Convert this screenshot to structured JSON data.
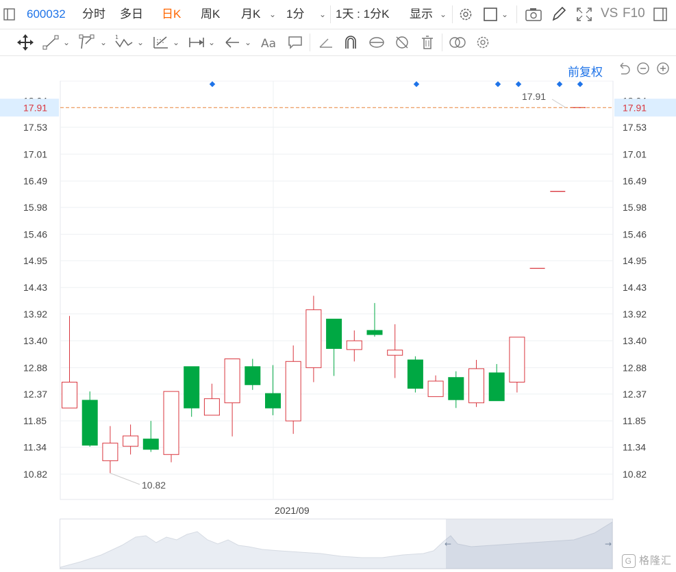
{
  "toolbar": {
    "symbol": "600032",
    "tabs": [
      "分时",
      "多日",
      "日K",
      "周K",
      "月K",
      "1分"
    ],
    "active_tab": "日K",
    "interval_label": "1天 : 1分K",
    "display_label": "显示",
    "vs_label": "VS",
    "f10_label": "F10"
  },
  "adjust_label": "前复权",
  "chart": {
    "current_price": "17.91",
    "high_label": "17.91",
    "low_label": "10.82",
    "top_axis_partial": "18.04",
    "x_label": "2021/09",
    "y_ticks": [
      "17.53",
      "17.01",
      "16.49",
      "15.98",
      "15.46",
      "14.95",
      "14.43",
      "13.92",
      "13.40",
      "12.88",
      "12.37",
      "11.85",
      "11.34",
      "10.82"
    ]
  },
  "colors": {
    "up": "#d9363e",
    "down": "#00a843",
    "accent": "#1e73e8",
    "active": "#ff6600"
  },
  "watermark": "格隆汇",
  "chart_data": {
    "type": "candlestick",
    "x_label": "2021/09",
    "ylim": [
      10.82,
      18.04
    ],
    "candles": [
      {
        "o": 12.1,
        "h": 13.88,
        "l": 12.1,
        "c": 12.6
      },
      {
        "o": 12.25,
        "h": 12.42,
        "l": 11.35,
        "c": 11.38
      },
      {
        "o": 11.08,
        "h": 11.75,
        "l": 10.84,
        "c": 11.42
      },
      {
        "o": 11.36,
        "h": 11.78,
        "l": 11.2,
        "c": 11.56
      },
      {
        "o": 11.5,
        "h": 11.85,
        "l": 11.25,
        "c": 11.3
      },
      {
        "o": 11.2,
        "h": 12.4,
        "l": 11.05,
        "c": 12.42
      },
      {
        "o": 12.9,
        "h": 12.9,
        "l": 11.93,
        "c": 12.1
      },
      {
        "o": 11.96,
        "h": 12.57,
        "l": 11.96,
        "c": 12.28
      },
      {
        "o": 12.2,
        "h": 13.05,
        "l": 11.55,
        "c": 13.05
      },
      {
        "o": 12.9,
        "h": 13.05,
        "l": 12.45,
        "c": 12.55
      },
      {
        "o": 12.38,
        "h": 12.93,
        "l": 11.96,
        "c": 12.1
      },
      {
        "o": 11.85,
        "h": 13.31,
        "l": 11.6,
        "c": 13.0
      },
      {
        "o": 12.88,
        "h": 14.27,
        "l": 12.6,
        "c": 14.0
      },
      {
        "o": 13.82,
        "h": 13.82,
        "l": 12.72,
        "c": 13.25
      },
      {
        "o": 13.23,
        "h": 13.6,
        "l": 13.0,
        "c": 13.4
      },
      {
        "o": 13.6,
        "h": 14.13,
        "l": 13.48,
        "c": 13.52
      },
      {
        "o": 13.12,
        "h": 13.72,
        "l": 12.68,
        "c": 13.22
      },
      {
        "o": 13.03,
        "h": 13.1,
        "l": 12.4,
        "c": 12.48
      },
      {
        "o": 12.32,
        "h": 12.73,
        "l": 12.32,
        "c": 12.62
      },
      {
        "o": 12.69,
        "h": 12.81,
        "l": 12.1,
        "c": 12.26
      },
      {
        "o": 12.2,
        "h": 13.03,
        "l": 12.12,
        "c": 12.86
      },
      {
        "o": 12.78,
        "h": 12.95,
        "l": 12.24,
        "c": 12.24
      },
      {
        "o": 12.6,
        "h": 13.47,
        "l": 12.4,
        "c": 13.47
      },
      {
        "o": 14.8,
        "h": 14.8,
        "l": 14.8,
        "c": 14.8
      },
      {
        "o": 16.29,
        "h": 16.29,
        "l": 16.29,
        "c": 16.29
      },
      {
        "o": 17.91,
        "h": 17.91,
        "l": 17.91,
        "c": 17.91
      }
    ],
    "current_price": 17.91
  }
}
